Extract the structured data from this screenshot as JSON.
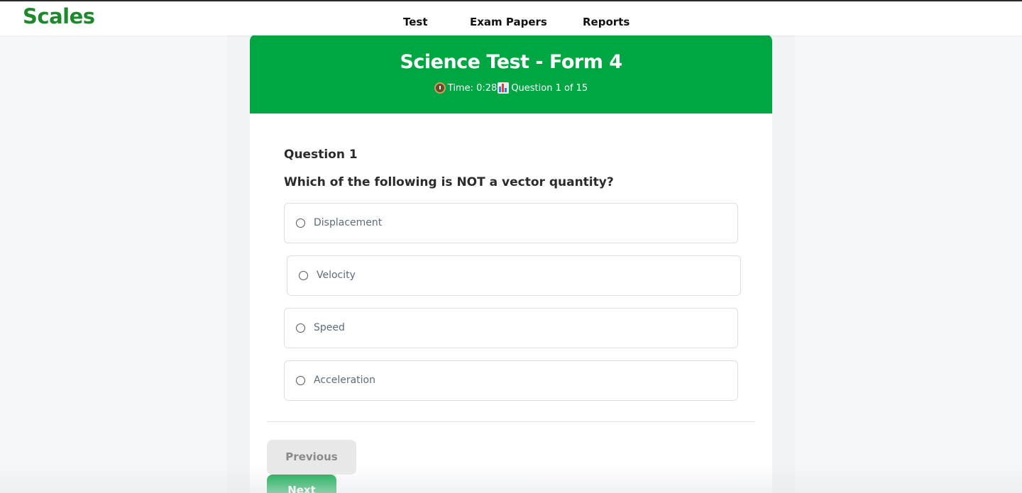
{
  "navbar": {
    "logo": "Scales",
    "links": [
      "Test",
      "Exam Papers",
      "Reports"
    ]
  },
  "exam": {
    "title": "Science Test - Form 4",
    "time_label": "Time: 0:28",
    "progress_label": "Question 1 of 15",
    "clock_icon": "alarm-clock-icon",
    "progress_icon": "bar-chart-icon"
  },
  "question": {
    "heading": "Question 1",
    "text": "Which of the following is NOT a vector quantity?",
    "options": [
      "Displacement",
      "Velocity",
      "Speed",
      "Acceleration"
    ],
    "selected": null
  },
  "buttons": {
    "previous": "Previous",
    "next": "Next"
  },
  "colors": {
    "brand_green": "#1c8a2a",
    "header_green": "#00a642",
    "disabled_gray": "#e8e8e8"
  }
}
